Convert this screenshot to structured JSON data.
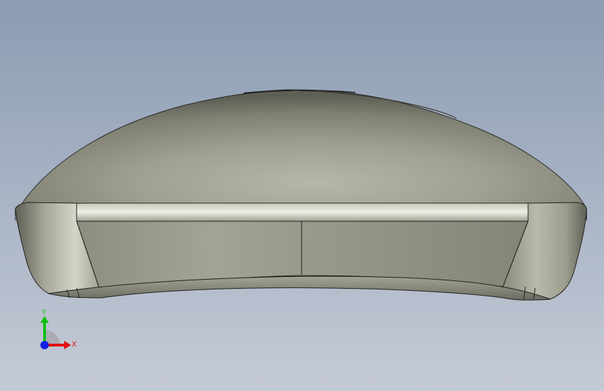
{
  "viewport": {
    "background_top": "#8c9db4",
    "background_bottom": "#c3c8d4",
    "model_base_color": "#8f9080"
  },
  "triad": {
    "x_label": "X",
    "y_label": "Y",
    "x_color": "#e01010",
    "y_color": "#10c010",
    "z_color": "#1020e0"
  }
}
